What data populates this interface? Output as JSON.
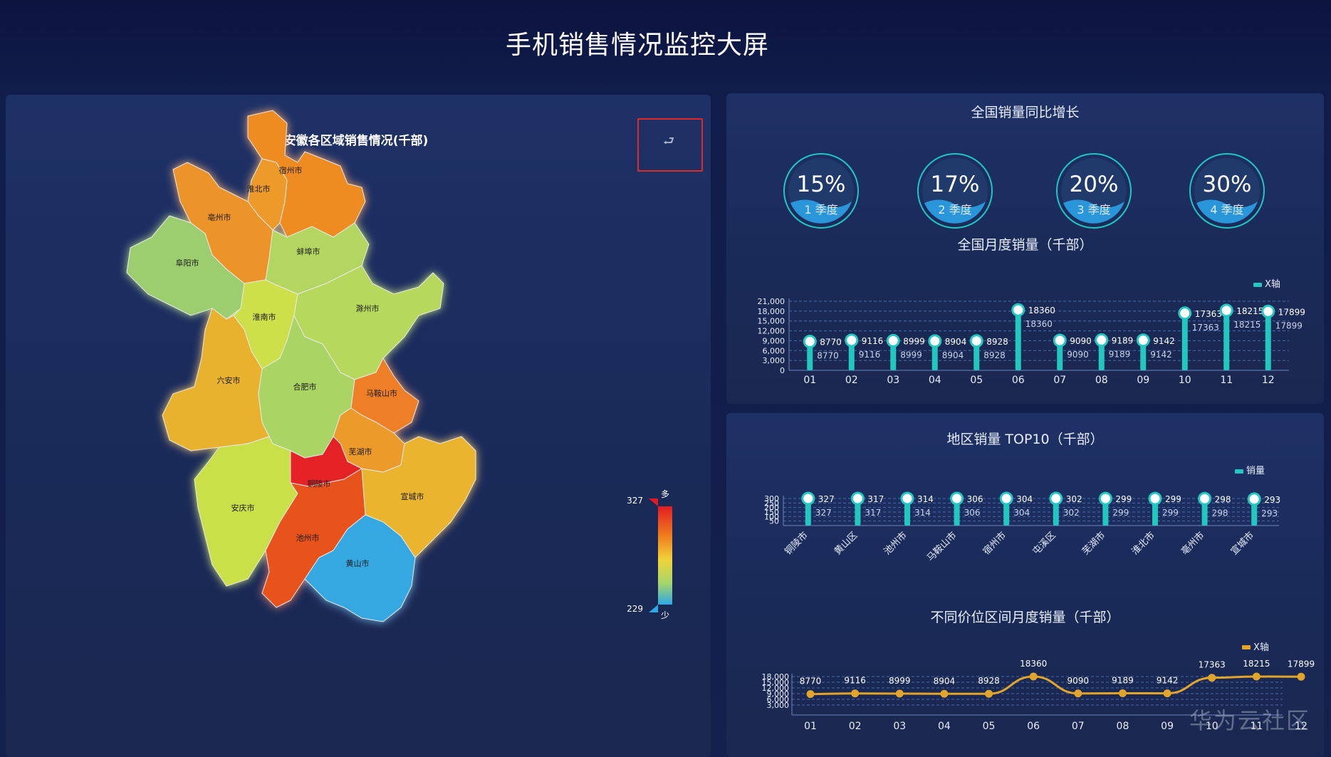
{
  "page": {
    "title": "手机销售情况监控大屏"
  },
  "map": {
    "title": "安徽各区域销售情况(千部)",
    "back_icon": "back-arrow-icon",
    "visual_map": {
      "max_label": "327",
      "min_label": "229",
      "high_text": "多",
      "low_text": "少",
      "colors": [
        "#e21b22",
        "#f07e1e",
        "#f0d43a",
        "#a6d66a",
        "#2ea8e6"
      ]
    },
    "regions": [
      {
        "name": "宿州市",
        "color": "#ee8c24"
      },
      {
        "name": "淮北市",
        "color": "#ee9a2a"
      },
      {
        "name": "亳州市",
        "color": "#ec942a"
      },
      {
        "name": "阜阳市",
        "color": "#9ccd6e"
      },
      {
        "name": "蚌埠市",
        "color": "#b2d660"
      },
      {
        "name": "淮南市",
        "color": "#cde04a"
      },
      {
        "name": "滁州市",
        "color": "#b6d85c"
      },
      {
        "name": "六安市",
        "color": "#e8b22e"
      },
      {
        "name": "合肥市",
        "color": "#aad463"
      },
      {
        "name": "马鞍山市",
        "color": "#ee7f27"
      },
      {
        "name": "芜湖市",
        "color": "#ec9a2a"
      },
      {
        "name": "铜陵市",
        "color": "#e52327"
      },
      {
        "name": "安庆市",
        "color": "#c9e04a"
      },
      {
        "name": "宣城市",
        "color": "#eab42e"
      },
      {
        "name": "池州市",
        "color": "#e8521f"
      },
      {
        "name": "黄山市",
        "color": "#36a8e2"
      }
    ]
  },
  "growth": {
    "title": "全国销量同比增长",
    "rings": [
      {
        "value": "15%",
        "label": "1 季度"
      },
      {
        "value": "17%",
        "label": "2 季度"
      },
      {
        "value": "20%",
        "label": "3 季度"
      },
      {
        "value": "30%",
        "label": "4 季度"
      }
    ],
    "ring_color": "#1fc7c2"
  },
  "chart_data": [
    {
      "type": "bar",
      "title": "全国月度销量（千部）",
      "legend": "X轴",
      "categories": [
        "01",
        "02",
        "03",
        "04",
        "05",
        "06",
        "07",
        "08",
        "09",
        "10",
        "11",
        "12"
      ],
      "values": [
        8770,
        9116,
        8999,
        8904,
        8928,
        18360,
        9090,
        9189,
        9142,
        17363,
        18215,
        17899
      ],
      "yticks": [
        "21,000",
        "18,000",
        "15,000",
        "12,000",
        "9,000",
        "6,000",
        "3,000",
        "0"
      ],
      "ylim": [
        0,
        21000
      ],
      "color": "#22c7c0"
    },
    {
      "type": "bar",
      "title": "地区销量 TOP10（千部）",
      "legend": "销量",
      "categories": [
        "铜陵市",
        "黄山区",
        "池州市",
        "马鞍山市",
        "宿州市",
        "屯溪区",
        "芜湖市",
        "淮北市",
        "亳州市",
        "宣城市"
      ],
      "values": [
        327,
        317,
        314,
        306,
        304,
        302,
        299,
        299,
        298,
        293
      ],
      "yticks": [
        "300",
        "250",
        "200",
        "150",
        "100",
        "50"
      ],
      "ylim": [
        0,
        300
      ],
      "color": "#22c7c0"
    },
    {
      "type": "line",
      "title": "不同价位区间月度销量（千部）",
      "legend": "X轴",
      "categories": [
        "01",
        "02",
        "03",
        "04",
        "05",
        "06",
        "07",
        "08",
        "09",
        "10",
        "11",
        "12"
      ],
      "values": [
        8770,
        9116,
        8999,
        8904,
        8928,
        18360,
        9090,
        9189,
        9142,
        17363,
        18215,
        17899
      ],
      "yticks": [
        "18,000",
        "15,000",
        "12,000",
        "9,000",
        "6,000",
        "3,000"
      ],
      "ylim": [
        0,
        18000
      ],
      "color": "#e2a52c"
    }
  ],
  "watermark": "华为云社区"
}
